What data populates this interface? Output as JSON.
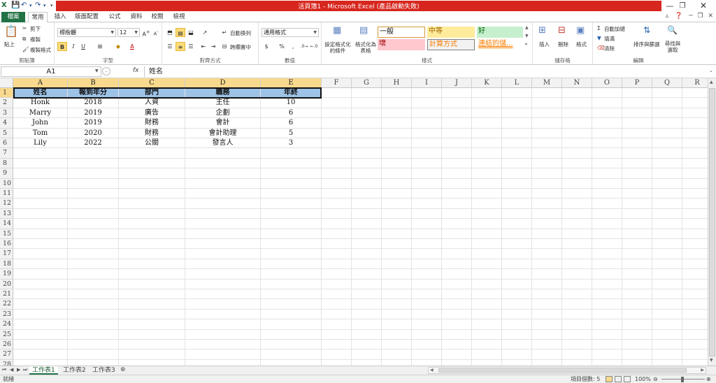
{
  "window": {
    "title": "活頁簿1 - Microsoft Excel (產品啟動失敗)",
    "accent": "#217346",
    "titlebar_color": "#d7261e"
  },
  "tabs": [
    {
      "label": "檔案",
      "active": false
    },
    {
      "label": "常用",
      "active": true
    },
    {
      "label": "插入",
      "active": false
    },
    {
      "label": "版面配置",
      "active": false
    },
    {
      "label": "公式",
      "active": false
    },
    {
      "label": "資料",
      "active": false
    },
    {
      "label": "校閱",
      "active": false
    },
    {
      "label": "檢視",
      "active": false
    }
  ],
  "ribbon": {
    "clipboard": {
      "label": "剪貼簿",
      "paste": "貼上",
      "cut": "剪下",
      "copy": "複製",
      "format_painter": "複製格式"
    },
    "font": {
      "label": "字型",
      "font_name": "標楷體",
      "font_size": "12",
      "bold": "B",
      "italic": "I",
      "underline": "U"
    },
    "alignment": {
      "label": "對齊方式",
      "wrap_text": "自動換列",
      "merge_center": "跨欄置中"
    },
    "number": {
      "label": "數值",
      "format": "通用格式",
      "currency": "$",
      "percent": "%",
      "comma": ","
    },
    "styles": {
      "label": "樣式",
      "conditional_formatting": "設定格式化的條件",
      "format_as_table": "格式化為表格",
      "items": [
        {
          "text": "一般",
          "bg": "#ffffff",
          "border": "#d59a3a",
          "color": "#111111"
        },
        {
          "text": "中等",
          "bg": "#ffeb9c",
          "border": "#ffeb9c",
          "color": "#9c6500"
        },
        {
          "text": "好",
          "bg": "#c6efce",
          "border": "#c6efce",
          "color": "#006100"
        },
        {
          "text": "壞",
          "bg": "#ffc7ce",
          "border": "#ffc7ce",
          "color": "#9c0006"
        },
        {
          "text": "計算方式",
          "bg": "#f2f2f2",
          "border": "#7f7f7f",
          "color": "#fa7d00"
        },
        {
          "text": "連結的儲...",
          "bg": "#ffffff",
          "border": "#ffffff",
          "color": "#fa7d00"
        }
      ]
    },
    "cells": {
      "label": "儲存格",
      "insert": "插入",
      "delete": "刪除",
      "format": "格式"
    },
    "editing": {
      "label": "編輯",
      "autosum": "自動加總",
      "fill": "填滿",
      "clear": "清除",
      "sort_filter": "排序與篩選",
      "find_select": "尋找與選取"
    }
  },
  "formula_bar": {
    "name_box": "A1",
    "fx": "fx",
    "value": "姓名"
  },
  "sheet": {
    "columns": [
      "A",
      "B",
      "C",
      "D",
      "E",
      "F",
      "G",
      "H",
      "I",
      "J",
      "K",
      "L",
      "M",
      "N",
      "O",
      "P",
      "Q",
      "R"
    ],
    "rows": [
      "1",
      "2",
      "3",
      "4",
      "5",
      "6",
      "7",
      "8",
      "9",
      "10",
      "11",
      "12",
      "13",
      "14",
      "15",
      "16",
      "17",
      "18",
      "19",
      "20",
      "21",
      "22",
      "23",
      "24",
      "25",
      "26",
      "27",
      "28"
    ],
    "header_fill": "#9dc3e6",
    "data": [
      [
        "姓名",
        "報到年分",
        "部門",
        "職務",
        "年終"
      ],
      [
        "Honk",
        "2018",
        "人資",
        "主任",
        "10"
      ],
      [
        "Marry",
        "2019",
        "廣告",
        "企劃",
        "6"
      ],
      [
        "John",
        "2019",
        "財務",
        "會計",
        "6"
      ],
      [
        "Tom",
        "2020",
        "財務",
        "會計助理",
        "5"
      ],
      [
        "Lily",
        "2022",
        "公關",
        "發言人",
        "3"
      ]
    ]
  },
  "sheet_tabs": [
    {
      "label": "工作表1",
      "active": true
    },
    {
      "label": "工作表2",
      "active": false
    },
    {
      "label": "工作表3",
      "active": false
    }
  ],
  "status_bar": {
    "ready": "就緒",
    "count": "項目個數: 5",
    "zoom": "100%"
  }
}
